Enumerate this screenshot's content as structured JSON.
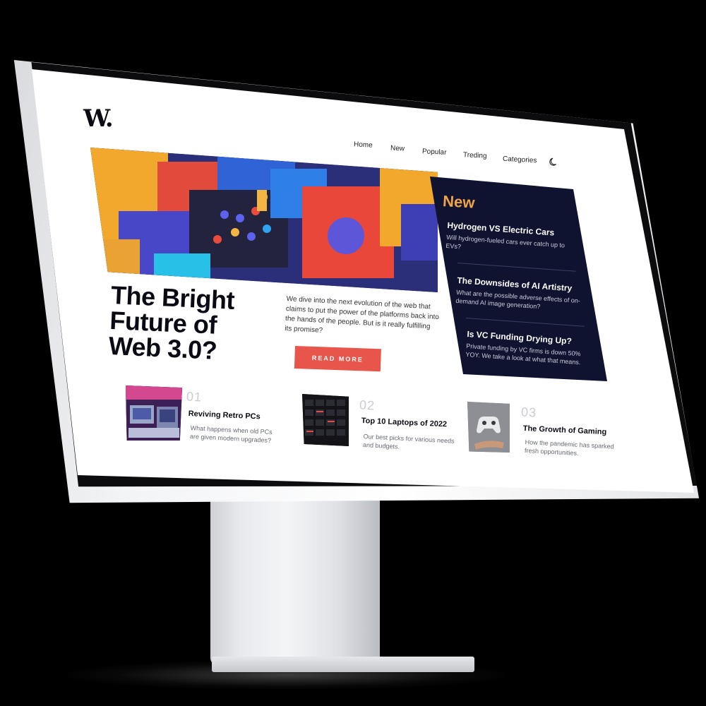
{
  "brand": {
    "logo": "W."
  },
  "nav": {
    "home": "Home",
    "new": "New",
    "popular": "Popular",
    "trending": "Treding",
    "categories": "Categories"
  },
  "hero": {
    "title": "The Bright Future of Web 3.0?",
    "description": "We dive into the next evolution of the web that claims to put the power of the platforms back into the hands of the people. But is it really fulfilling its promise?",
    "button_label": "READ MORE"
  },
  "new_panel": {
    "heading": "New",
    "items": [
      {
        "title": "Hydrogen VS Electric Cars",
        "desc": "Will hydrogen-fueled cars ever catch up to EVs?"
      },
      {
        "title": "The Downsides of AI Artistry",
        "desc": "What are the possible adverse effects of on-demand AI image generation?"
      },
      {
        "title": "Is VC Funding Drying Up?",
        "desc": "Private funding by VC firms is down 50% YOY. We take a look at what that means."
      }
    ]
  },
  "cards": [
    {
      "number": "01",
      "title": "Reviving Retro PCs",
      "desc": "What happens when old PCs are given modern upgrades?"
    },
    {
      "number": "02",
      "title": "Top 10 Laptops of 2022",
      "desc": "Our best picks for various needs and budgets."
    },
    {
      "number": "03",
      "title": "The Growth of Gaming",
      "desc": "How the pandemic has sparked fresh opportunities."
    }
  ],
  "colors": {
    "accent": "#e8564b",
    "panel_bg": "#0f1330",
    "panel_heading": "#f0a44a"
  },
  "icons": {
    "theme_toggle": "moon-icon"
  }
}
